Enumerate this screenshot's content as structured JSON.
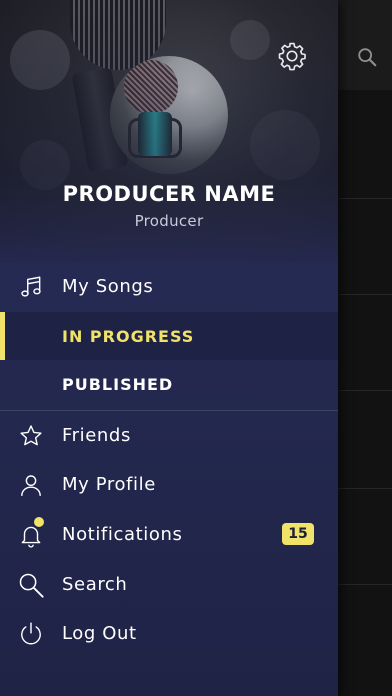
{
  "profile": {
    "name": "PRODUCER NAME",
    "role": "Producer"
  },
  "header_icons": {
    "settings": "gear-icon",
    "search": "search-icon"
  },
  "menu": {
    "my_songs": {
      "label": "My Songs",
      "icon": "music-note-icon"
    },
    "sub_items": [
      {
        "label": "IN PROGRESS",
        "active": true
      },
      {
        "label": "PUBLISHED",
        "active": false
      }
    ],
    "friends": {
      "label": "Friends",
      "icon": "star-icon"
    },
    "profile": {
      "label": "My Profile",
      "icon": "person-icon"
    },
    "notifications": {
      "label": "Notifications",
      "icon": "bell-icon",
      "badge": "15"
    },
    "search": {
      "label": "Search",
      "icon": "search-icon"
    },
    "logout": {
      "label": "Log Out",
      "icon": "power-icon"
    }
  },
  "colors": {
    "accent": "#f1e26a",
    "drawer_bg": "#262a52",
    "active_bg": "#1e2245",
    "text": "#ffffff",
    "subtext": "#c9cad6"
  }
}
